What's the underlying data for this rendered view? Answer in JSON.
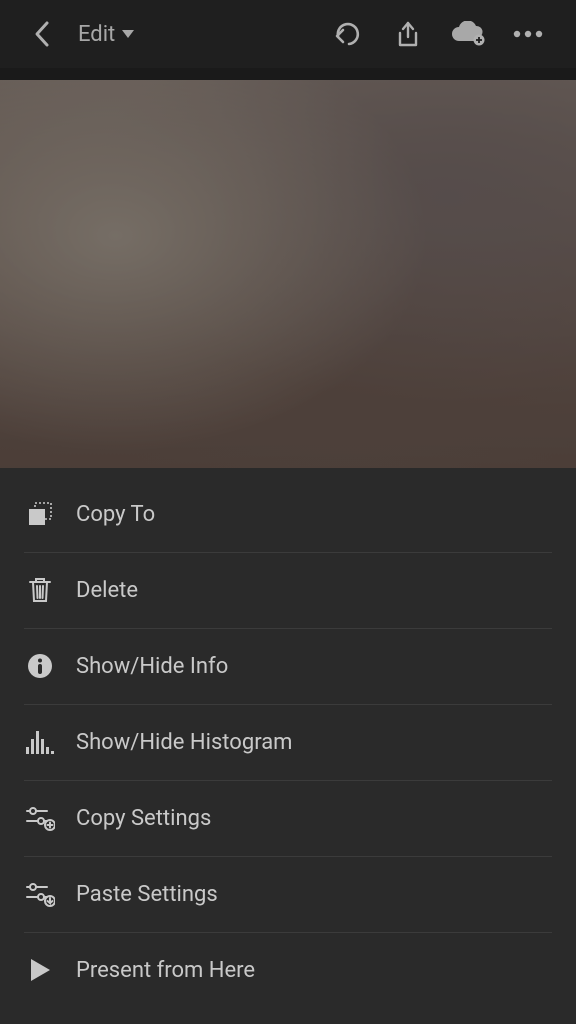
{
  "topbar": {
    "edit_label": "Edit"
  },
  "menu": {
    "items": [
      {
        "icon": "copy-to-icon",
        "label": "Copy To"
      },
      {
        "icon": "trash-icon",
        "label": "Delete"
      },
      {
        "icon": "info-icon",
        "label": "Show/Hide Info"
      },
      {
        "icon": "histogram-icon",
        "label": "Show/Hide Histogram"
      },
      {
        "icon": "copy-settings-icon",
        "label": "Copy Settings"
      },
      {
        "icon": "paste-settings-icon",
        "label": "Paste Settings"
      },
      {
        "icon": "play-icon",
        "label": "Present from Here"
      }
    ]
  }
}
